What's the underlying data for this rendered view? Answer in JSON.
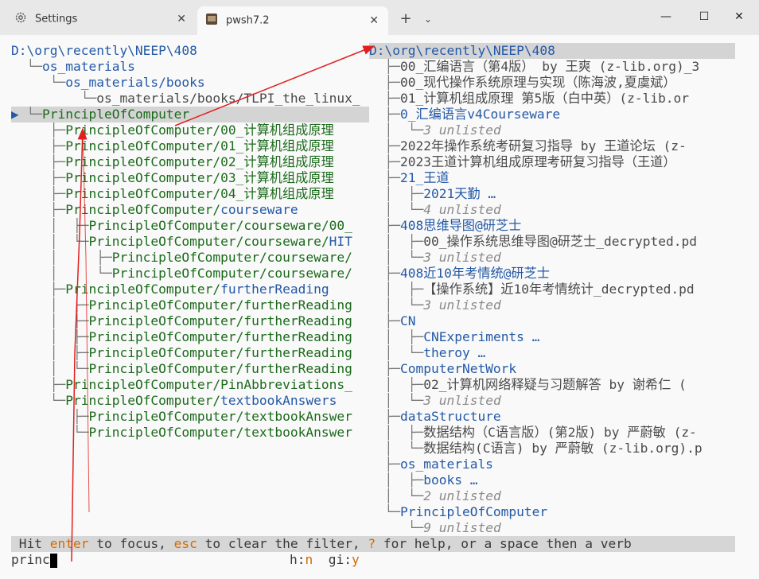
{
  "tabs": [
    {
      "title": "Settings",
      "icon": "gear-icon"
    },
    {
      "title": "pwsh7.2",
      "icon": "terminal-app-icon"
    }
  ],
  "tab_close": "✕",
  "new_tab": "+",
  "dropdown": "⌄",
  "window": {
    "minimize": "—",
    "maximize": "☐",
    "close": "✕"
  },
  "left_tree": [
    {
      "prefix": "",
      "text": "D:\\org\\recently\\NEEP\\408",
      "style": "blue"
    },
    {
      "prefix": "  └─",
      "text": "os_materials",
      "style": "blue"
    },
    {
      "prefix": "     └─",
      "text": "os_materials/books",
      "style": "blue"
    },
    {
      "prefix": "         └─",
      "text": "os_materials/books/TLPI_the_linux_",
      "style": "gray"
    },
    {
      "prefix": "▶ └─",
      "text": "PrincipleOfComputer",
      "style": "green",
      "selected": true
    },
    {
      "prefix": "     ├─",
      "text": "PrincipleOfComputer/00_计算机组成原理",
      "style": "green"
    },
    {
      "prefix": "     ├─",
      "text": "PrincipleOfComputer/01_计算机组成原理",
      "style": "green"
    },
    {
      "prefix": "     ├─",
      "text": "PrincipleOfComputer/02_计算机组成原理",
      "style": "green"
    },
    {
      "prefix": "     ├─",
      "text": "PrincipleOfComputer/03_计算机组成原理",
      "style": "green"
    },
    {
      "prefix": "     ├─",
      "text": "PrincipleOfComputer/04_计算机组成原理",
      "style": "green"
    },
    {
      "prefix": "     ├─",
      "text": "PrincipleOfComputer/courseware",
      "style": "green_blue",
      "split": 20
    },
    {
      "prefix": "     │  ├─",
      "text": "PrincipleOfComputer/courseware/00_",
      "style": "green"
    },
    {
      "prefix": "     │  └─",
      "text": "PrincipleOfComputer/courseware/HIT",
      "style": "green_blue",
      "split": 31
    },
    {
      "prefix": "     │     ├─",
      "text": "PrincipleOfComputer/courseware/",
      "style": "green"
    },
    {
      "prefix": "     │     └─",
      "text": "PrincipleOfComputer/courseware/",
      "style": "green"
    },
    {
      "prefix": "     ├─",
      "text": "PrincipleOfComputer/furtherReading",
      "style": "green_blue",
      "split": 20
    },
    {
      "prefix": "     │  ├─",
      "text": "PrincipleOfComputer/furtherReading",
      "style": "green"
    },
    {
      "prefix": "     │  ├─",
      "text": "PrincipleOfComputer/furtherReading",
      "style": "green"
    },
    {
      "prefix": "     │  ├─",
      "text": "PrincipleOfComputer/furtherReading",
      "style": "green"
    },
    {
      "prefix": "     │  ├─",
      "text": "PrincipleOfComputer/furtherReading",
      "style": "green"
    },
    {
      "prefix": "     │  └─",
      "text": "PrincipleOfComputer/furtherReading",
      "style": "green"
    },
    {
      "prefix": "     ├─",
      "text": "PrincipleOfComputer/PinAbbreviations_",
      "style": "green"
    },
    {
      "prefix": "     └─",
      "text": "PrincipleOfComputer/textbookAnswers",
      "style": "green_blue",
      "split": 20
    },
    {
      "prefix": "        ├─",
      "text": "PrincipleOfComputer/textbookAnswer",
      "style": "green"
    },
    {
      "prefix": "        └─",
      "text": "PrincipleOfComputer/textbookAnswer",
      "style": "green"
    }
  ],
  "right_tree": [
    {
      "prefix": "",
      "text": "D:\\org\\recently\\NEEP\\408",
      "style": "blue",
      "selected": true
    },
    {
      "prefix": "  ├─",
      "text": "00_汇编语言（第4版） by 王爽 (z-lib.org)_3",
      "style": "gray"
    },
    {
      "prefix": "  ├─",
      "text": "00_现代操作系统原理与实现（陈海波,夏虞斌）",
      "style": "gray"
    },
    {
      "prefix": "  ├─",
      "text": "01_计算机组成原理 第5版（白中英）(z-lib.or",
      "style": "gray"
    },
    {
      "prefix": "  ├─",
      "text": "0_汇编语言v4Courseware",
      "style": "blue"
    },
    {
      "prefix": "  │  └─",
      "text": "3 unlisted",
      "style": "unl"
    },
    {
      "prefix": "  ├─",
      "text": "2022年操作系统考研复习指导 by 王道论坛 (z-",
      "style": "gray"
    },
    {
      "prefix": "  ├─",
      "text": "2023王道计算机组成原理考研复习指导（王道）",
      "style": "gray"
    },
    {
      "prefix": "  ├─",
      "text": "21_王道",
      "style": "blue"
    },
    {
      "prefix": "  │  ├─",
      "text": "2021天勤 …",
      "style": "blue"
    },
    {
      "prefix": "  │  └─",
      "text": "4 unlisted",
      "style": "unl"
    },
    {
      "prefix": "  ├─",
      "text": "408思维导图@研芝士",
      "style": "blue"
    },
    {
      "prefix": "  │  ├─",
      "text": "00_操作系统思维导图@研芝士_decrypted.pd",
      "style": "gray"
    },
    {
      "prefix": "  │  └─",
      "text": "3 unlisted",
      "style": "unl"
    },
    {
      "prefix": "  ├─",
      "text": "408近10年考情统@研芝士",
      "style": "blue"
    },
    {
      "prefix": "  │  ├─",
      "text": "【操作系统】近10年考情统计_decrypted.pd",
      "style": "gray"
    },
    {
      "prefix": "  │  └─",
      "text": "3 unlisted",
      "style": "unl"
    },
    {
      "prefix": "  ├─",
      "text": "CN",
      "style": "blue"
    },
    {
      "prefix": "  │  ├─",
      "text": "CNExperiments …",
      "style": "blue"
    },
    {
      "prefix": "  │  └─",
      "text": "theroy …",
      "style": "blue"
    },
    {
      "prefix": "  ├─",
      "text": "ComputerNetWork",
      "style": "blue"
    },
    {
      "prefix": "  │  ├─",
      "text": "02_计算机网络释疑与习题解答 by 谢希仁 (",
      "style": "gray"
    },
    {
      "prefix": "  │  └─",
      "text": "3 unlisted",
      "style": "unl"
    },
    {
      "prefix": "  ├─",
      "text": "dataStructure",
      "style": "blue"
    },
    {
      "prefix": "  │  ├─",
      "text": "数据结构（C语言版）(第2版) by 严蔚敏 (z-",
      "style": "gray"
    },
    {
      "prefix": "  │  └─",
      "text": "数据结构(C语言) by 严蔚敏 (z-lib.org).p",
      "style": "gray"
    },
    {
      "prefix": "  ├─",
      "text": "os_materials",
      "style": "blue"
    },
    {
      "prefix": "  │  ├─",
      "text": "books …",
      "style": "blue"
    },
    {
      "prefix": "  │  └─",
      "text": "2 unlisted",
      "style": "unl"
    },
    {
      "prefix": "  └─",
      "text": "PrincipleOfComputer",
      "style": "blue"
    },
    {
      "prefix": "     └─",
      "text": "9 unlisted",
      "style": "unl"
    }
  ],
  "status": {
    "p1": " Hit ",
    "enter": "enter",
    "p2": " to focus, ",
    "esc": "esc",
    "p3": " to clear the filter, ",
    "help": "?",
    "p4": " for help, or a space then a verb"
  },
  "input": {
    "filter": "princ",
    "hint_h_key": "h:",
    "hint_h_val": "n",
    "hint_gi_key": "gi:",
    "hint_gi_val": "y"
  },
  "colors": {
    "accent_orange": "#d46a00",
    "tree_green": "#1b6a1b",
    "dir_blue": "#2459a6",
    "annotation_red": "#e02020"
  }
}
